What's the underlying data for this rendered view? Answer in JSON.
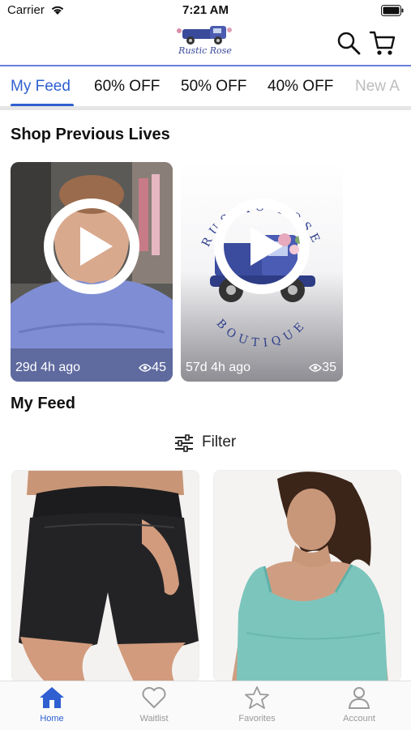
{
  "status_bar": {
    "carrier": "Carrier",
    "time": "7:21 AM"
  },
  "header": {
    "logo_text": "Rustic Rose",
    "icons": [
      "search-icon",
      "cart-icon"
    ]
  },
  "tabs": [
    {
      "label": "My Feed",
      "active": true
    },
    {
      "label": "60% OFF"
    },
    {
      "label": "50% OFF"
    },
    {
      "label": "40% OFF"
    },
    {
      "label": "New A"
    }
  ],
  "lives": {
    "title": "Shop Previous Lives",
    "items": [
      {
        "ago": "29d 4h ago",
        "views": "45"
      },
      {
        "ago": "57d 4h ago",
        "views": "35",
        "brand_top": "RUSTIC ROSE",
        "brand_bottom": "BOUTIQUE"
      }
    ]
  },
  "feed": {
    "title": "My Feed",
    "filter_label": "Filter"
  },
  "bottom_nav": [
    {
      "label": "Home",
      "icon": "home-icon",
      "active": true
    },
    {
      "label": "Waitlist",
      "icon": "heart-icon"
    },
    {
      "label": "Favorites",
      "icon": "star-icon"
    },
    {
      "label": "Account",
      "icon": "user-icon"
    }
  ],
  "colors": {
    "accent": "#2f5fd0",
    "divider": "#6a7fd8"
  }
}
